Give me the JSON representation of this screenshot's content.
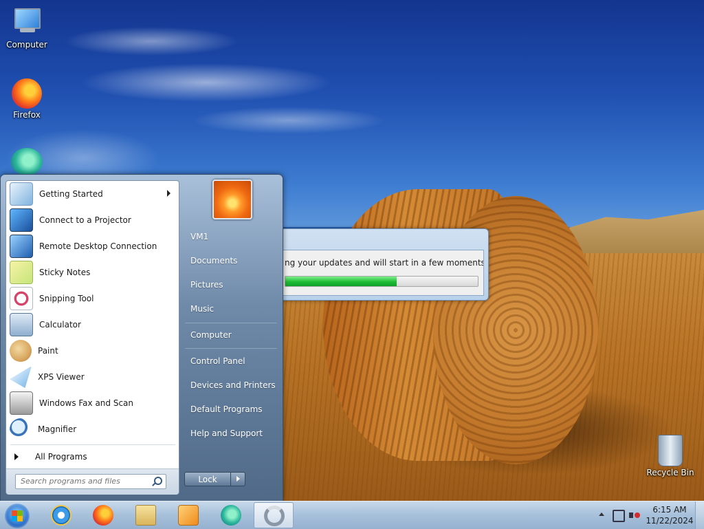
{
  "desktop": {
    "icons": [
      {
        "label": "Computer",
        "icon": "computer-icon"
      },
      {
        "label": "Firefox",
        "icon": "firefox-icon"
      },
      {
        "label": "",
        "icon": "edge-icon"
      },
      {
        "label": "Recycle Bin",
        "icon": "recycle-bin-icon"
      }
    ]
  },
  "dialog": {
    "message": "ng your updates and will start in a few moments...",
    "progress_fraction": 0.58,
    "progress_color": "#1fbb35"
  },
  "start_menu": {
    "programs": [
      {
        "label": "Getting Started",
        "icon": "getting-started-icon",
        "has_submenu": true
      },
      {
        "label": "Connect to a Projector",
        "icon": "projector-icon"
      },
      {
        "label": "Remote Desktop Connection",
        "icon": "remote-desktop-icon"
      },
      {
        "label": "Sticky Notes",
        "icon": "sticky-notes-icon"
      },
      {
        "label": "Snipping Tool",
        "icon": "snipping-tool-icon"
      },
      {
        "label": "Calculator",
        "icon": "calculator-icon"
      },
      {
        "label": "Paint",
        "icon": "paint-icon"
      },
      {
        "label": "XPS Viewer",
        "icon": "xps-viewer-icon"
      },
      {
        "label": "Windows Fax and Scan",
        "icon": "fax-scan-icon"
      },
      {
        "label": "Magnifier",
        "icon": "magnifier-icon"
      }
    ],
    "all_programs": "All Programs",
    "search": {
      "placeholder": "Search programs and files"
    },
    "right": {
      "user": "VM1",
      "documents": "Documents",
      "pictures": "Pictures",
      "music": "Music",
      "computer": "Computer",
      "control_panel": "Control Panel",
      "devices": "Devices and Printers",
      "default_programs": "Default Programs",
      "help": "Help and Support"
    },
    "lock_label": "Lock"
  },
  "taskbar": {
    "pinned": [
      "internet-explorer-icon",
      "firefox-icon",
      "file-explorer-icon",
      "media-player-icon",
      "edge-icon",
      "update-spinner-icon"
    ],
    "clock": {
      "time": "6:15 AM",
      "date": "11/22/2024"
    }
  }
}
